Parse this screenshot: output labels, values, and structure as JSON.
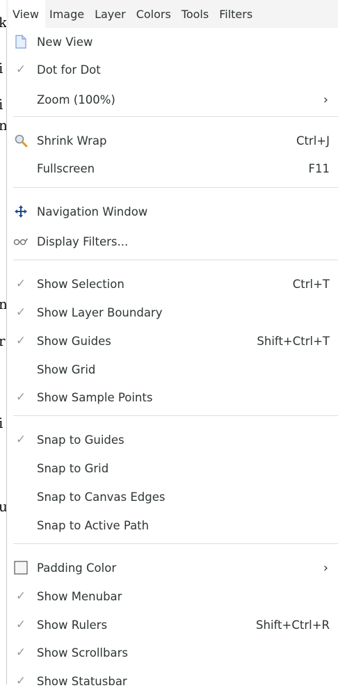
{
  "background_doc": {
    "fragments": [
      "k",
      "i",
      "i",
      "n",
      "n",
      "r",
      "i",
      "u"
    ]
  },
  "menubar": {
    "items": [
      {
        "label": "View",
        "active": true
      },
      {
        "label": "Image"
      },
      {
        "label": "Layer"
      },
      {
        "label": "Colors"
      },
      {
        "label": "Tools"
      },
      {
        "label": "Filters"
      }
    ]
  },
  "view_menu": {
    "items": [
      {
        "label": "New View",
        "icon": "new-view-icon"
      },
      {
        "label": "Dot for Dot",
        "icon": "check-icon"
      },
      {
        "label": "Zoom (100%)",
        "submenu": "›"
      },
      {
        "label": "Shrink Wrap",
        "icon": "magnifier-icon",
        "accel": "Ctrl+J"
      },
      {
        "label": "Fullscreen",
        "accel": "F11"
      },
      {
        "label": "Navigation Window",
        "icon": "navigation-icon"
      },
      {
        "label": "Display Filters...",
        "icon": "glasses-icon"
      },
      {
        "label": "Show Selection",
        "icon": "check-icon",
        "accel": "Ctrl+T"
      },
      {
        "label": "Show Layer Boundary",
        "icon": "check-icon"
      },
      {
        "label": "Show Guides",
        "icon": "check-icon",
        "accel": "Shift+Ctrl+T"
      },
      {
        "label": "Show Grid"
      },
      {
        "label": "Show Sample Points",
        "icon": "check-icon"
      },
      {
        "label": "Snap to Guides",
        "icon": "check-icon"
      },
      {
        "label": "Snap to Grid"
      },
      {
        "label": "Snap to Canvas Edges"
      },
      {
        "label": "Snap to Active Path"
      },
      {
        "label": "Padding Color",
        "icon": "color-swatch-icon",
        "submenu": "›"
      },
      {
        "label": "Show Menubar",
        "icon": "check-icon"
      },
      {
        "label": "Show Rulers",
        "icon": "check-icon",
        "accel": "Shift+Ctrl+R"
      },
      {
        "label": "Show Scrollbars",
        "icon": "check-icon"
      },
      {
        "label": "Show Statusbar",
        "icon": "check-icon"
      }
    ]
  },
  "colors": {
    "menubar_bg": "#f4f4f4",
    "text": "#2e3436",
    "check": "#9a9a9a",
    "nav_icon": "#204a87"
  }
}
